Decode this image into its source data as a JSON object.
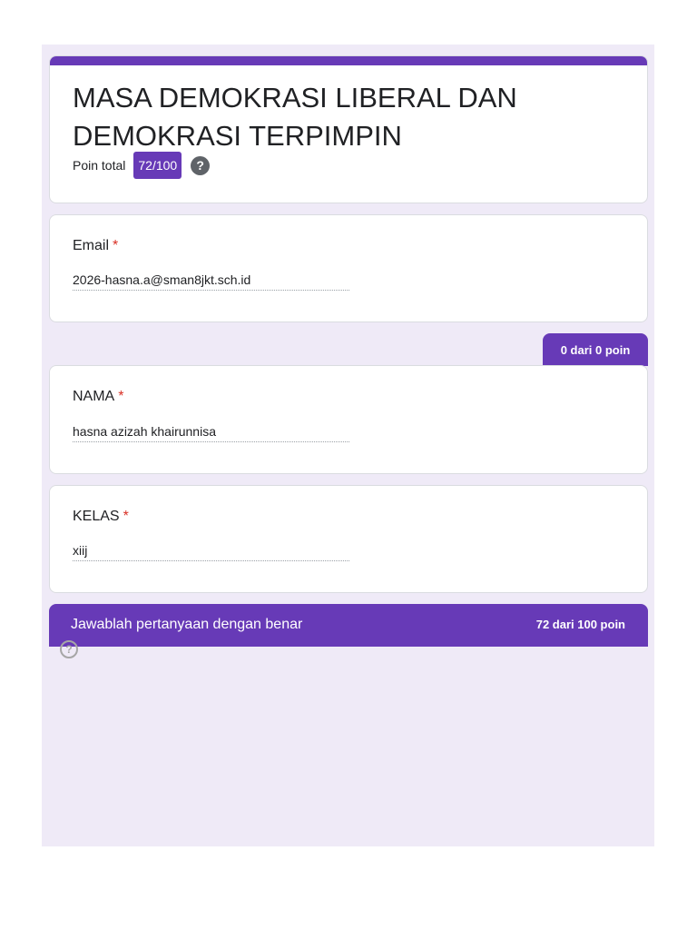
{
  "form": {
    "title": "MASA DEMOKRASI LIBERAL DAN DEMOKRASI TERPIMPIN",
    "score_label": "Poin total",
    "score_value": "72/100",
    "help_glyph": "?"
  },
  "questions": {
    "email": {
      "label": "Email",
      "required_mark": "*",
      "answer": "2026-hasna.a@sman8jkt.sch.id"
    },
    "nama": {
      "label": "NAMA",
      "required_mark": "*",
      "answer": "hasna azizah khairunnisa",
      "points": "0 dari 0 poin"
    },
    "kelas": {
      "label": "KELAS",
      "required_mark": "*",
      "answer": "xiij"
    }
  },
  "section": {
    "title": "Jawablah pertanyaan dengan benar",
    "points": "72 dari 100 poin",
    "help_glyph": "?"
  },
  "colors": {
    "accent": "#673ab7",
    "background": "#efeaf7",
    "required": "#d93025"
  },
  "icons": {
    "score_help": "help-circle-icon",
    "section_help": "help-outline-icon"
  }
}
